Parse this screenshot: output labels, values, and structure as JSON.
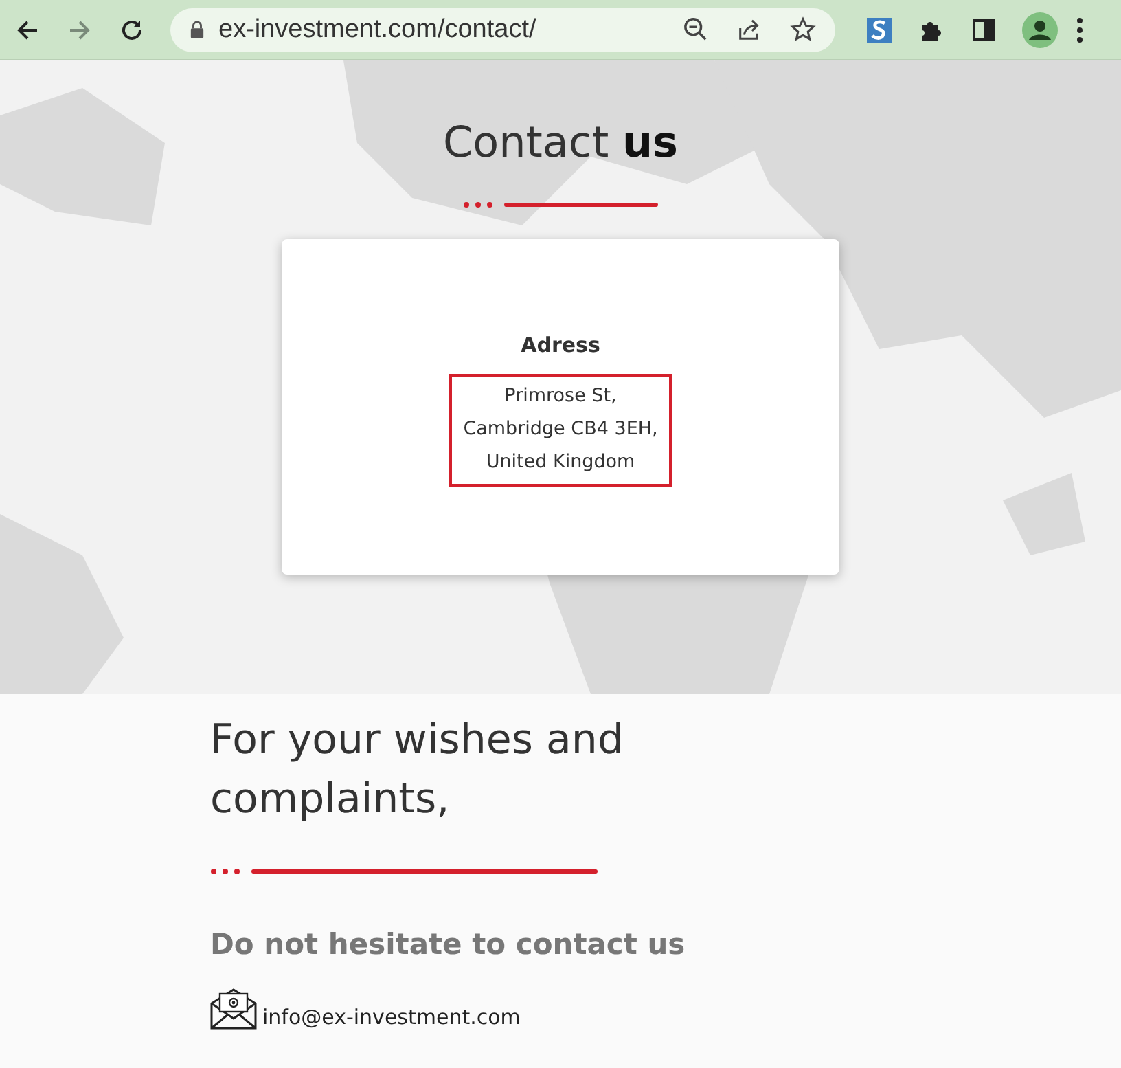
{
  "browser": {
    "url": "ex-investment.com/contact/"
  },
  "contact": {
    "title": "Contact **us**",
    "address_label": "Adress",
    "address": "Primrose St,\nCambridge CB4 3EH,\nUnited Kingdom",
    "highlighted": true
  },
  "wishes": {
    "heading": "For your wishes and complaints,",
    "subheading": "Do not hesitate to contact us",
    "email": "info@ex-investment.com"
  }
}
